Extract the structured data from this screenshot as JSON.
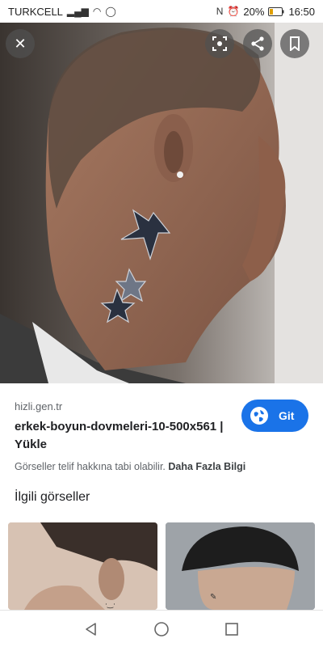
{
  "status_bar": {
    "carrier": "TURKCELL",
    "battery": "20%",
    "time": "16:50"
  },
  "image_viewer": {
    "close_icon": "close-icon",
    "lens_icon": "lens-icon",
    "share_icon": "share-icon",
    "bookmark_icon": "bookmark-icon"
  },
  "result": {
    "source": "hizli.gen.tr",
    "title": "erkek-boyun-dovmeleri-10-500x561 | Yükle",
    "visit_label": "Git",
    "copyright_text": "Görseller telif hakkına tabi olabilir.",
    "more_info_link": "Daha Fazla Bilgi"
  },
  "related": {
    "heading": "İlgili görseller"
  },
  "nav_bar": {
    "back": "back-icon",
    "home": "home-icon",
    "recents": "recents-icon"
  },
  "colors": {
    "accent": "#1a73e8"
  }
}
